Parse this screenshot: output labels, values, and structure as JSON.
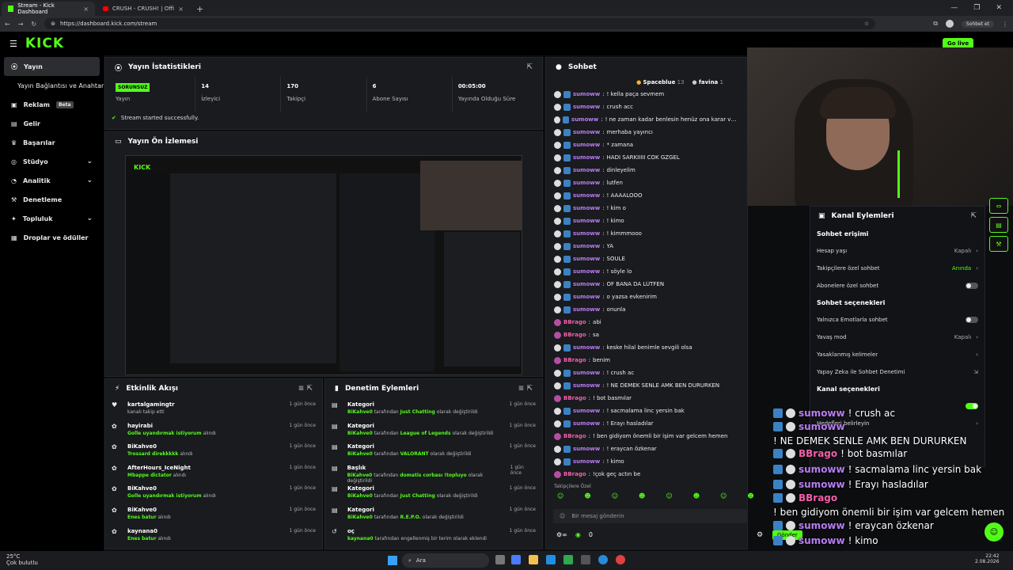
{
  "browser": {
    "tabs": [
      {
        "label": "Stream - Kick Dashboard",
        "active": true
      },
      {
        "label": "CRUSH - CRUSH! | Official Music V",
        "active": false
      }
    ],
    "url": "https://dashboard.kick.com/stream",
    "chat_button": "Sohbet et"
  },
  "topbar": {
    "logo": "KICK",
    "golive": "Go live"
  },
  "sidebar": {
    "items": [
      {
        "label": "Yayın",
        "icon": "broadcast-icon",
        "active": true
      },
      {
        "label": "Yayın Bağlantısı ve Anahtarı",
        "icon": "",
        "sub": true
      },
      {
        "label": "Reklam",
        "icon": "ad-icon",
        "badge": "Beta"
      },
      {
        "label": "Gelir",
        "icon": "revenue-icon"
      },
      {
        "label": "Başarılar",
        "icon": "trophy-icon"
      },
      {
        "label": "Stüdyo",
        "icon": "studio-icon",
        "chevron": true
      },
      {
        "label": "Analitik",
        "icon": "analytics-icon",
        "chevron": true
      },
      {
        "label": "Denetleme",
        "icon": "moderation-icon"
      },
      {
        "label": "Topluluk",
        "icon": "community-icon",
        "chevron": true
      },
      {
        "label": "Droplar ve ödüller",
        "icon": "drops-icon"
      }
    ]
  },
  "stats": {
    "title": "Yayın İstatistikleri",
    "items": [
      {
        "value": "SORUNSUZ",
        "label": "Yayın",
        "tag": true
      },
      {
        "value": "14",
        "label": "İzleyici"
      },
      {
        "value": "170",
        "label": "Takipçi"
      },
      {
        "value": "6",
        "label": "Abone Sayısı"
      },
      {
        "value": "00:05:00",
        "label": "Yayında Olduğu Süre"
      }
    ],
    "status": "Stream started successfully."
  },
  "preview": {
    "title": "Yayın Ön İzlemesi"
  },
  "activity": {
    "title": "Etkinlik Akışı",
    "items": [
      {
        "user": "kartalgamingtr",
        "text": "kanalı takip etti",
        "highlight": "",
        "ago": "1 gün önce",
        "icon": "heart-icon"
      },
      {
        "user": "hayirabi",
        "text": "",
        "highlight": "Golle uyandırmak istiyorum",
        "suffix": "alındı",
        "ago": "1 gün önce",
        "icon": "reward-icon"
      },
      {
        "user": "BiKahve0",
        "text": "",
        "highlight": "Trossard direkkkkk",
        "suffix": "alındı",
        "ago": "1 gün önce",
        "icon": "reward-icon"
      },
      {
        "user": "AfterHours_IceNight",
        "text": "",
        "highlight": "Mbappe dictator",
        "suffix": "alındı",
        "ago": "1 gün önce",
        "icon": "reward-icon"
      },
      {
        "user": "BiKahve0",
        "text": "",
        "highlight": "Golle uyandırmak istiyorum",
        "suffix": "alındı",
        "ago": "1 gün önce",
        "icon": "reward-icon"
      },
      {
        "user": "BiKahve0",
        "text": "",
        "highlight": "Enes batur",
        "suffix": "alındı",
        "ago": "1 gün önce",
        "icon": "reward-icon"
      },
      {
        "user": "kaynana0",
        "text": "",
        "highlight": "Enes batur",
        "suffix": "alındı",
        "ago": "1 gün önce",
        "icon": "reward-icon"
      }
    ]
  },
  "moderation": {
    "title": "Denetim Eylemleri",
    "items": [
      {
        "title": "Kategori",
        "user": "BiKahve0",
        "mid": "tarafından",
        "highlight": "Just Chatting",
        "suffix": "olarak değiştirildi",
        "ago": "1 gün önce",
        "icon": "category-icon"
      },
      {
        "title": "Kategori",
        "user": "BiKahve0",
        "mid": "tarafından",
        "highlight": "League of Legends",
        "suffix": "olarak değiştirildi",
        "ago": "1 gün önce",
        "icon": "category-icon"
      },
      {
        "title": "Kategori",
        "user": "BiKahve0",
        "mid": "tarafından",
        "highlight": "VALORANT",
        "suffix": "olarak değiştirildi",
        "ago": "1 gün önce",
        "icon": "category-icon"
      },
      {
        "title": "Başlık",
        "user": "BiKahve0",
        "mid": "tarafından",
        "highlight": "domatis corbası !topluyo",
        "suffix": "olarak değiştirildi",
        "ago": "1 gün önce",
        "icon": "title-icon"
      },
      {
        "title": "Kategori",
        "user": "BiKahve0",
        "mid": "tarafından",
        "highlight": "Just Chatting",
        "suffix": "olarak değiştirildi",
        "ago": "1 gün önce",
        "icon": "category-icon"
      },
      {
        "title": "Kategori",
        "user": "BiKahve0",
        "mid": "tarafından",
        "highlight": "R.E.P.O.",
        "suffix": "olarak değiştirildi",
        "ago": "1 gün önce",
        "icon": "category-icon"
      },
      {
        "title": "oç",
        "user": "kaynana0",
        "mid": "tarafından engellenmiş bir terim olarak eklendi",
        "highlight": "",
        "suffix": "",
        "ago": "1 gün önce",
        "icon": "undo-icon"
      }
    ]
  },
  "chat": {
    "title": "Sohbet",
    "pinned": [
      {
        "name": "Spaceblue",
        "count": "13"
      },
      {
        "name": "favina",
        "count": "1"
      }
    ],
    "messages": [
      {
        "user": "sumoww",
        "text": "! kella paça sevmem",
        "color": "#b97cf1"
      },
      {
        "user": "sumoww",
        "text": "crush acc",
        "color": "#b97cf1"
      },
      {
        "user": "sumoww",
        "text": "! ne zaman kadar benlesin henüz ona karar vermedim",
        "color": "#b97cf1"
      },
      {
        "user": "sumoww",
        "text": "merhaba yayıncı",
        "color": "#b97cf1"
      },
      {
        "user": "sumoww",
        "text": "* zamana",
        "color": "#b97cf1"
      },
      {
        "user": "sumoww",
        "text": "HADİ SARKIIIII COK GZĞEL",
        "color": "#b97cf1"
      },
      {
        "user": "sumoww",
        "text": "dinleyelim",
        "color": "#b97cf1"
      },
      {
        "user": "sumoww",
        "text": "lutfen",
        "color": "#b97cf1"
      },
      {
        "user": "sumoww",
        "text": "! AAAALOOO",
        "color": "#b97cf1"
      },
      {
        "user": "sumoww",
        "text": "! kim o",
        "color": "#b97cf1"
      },
      {
        "user": "sumoww",
        "text": "! kimo",
        "color": "#b97cf1"
      },
      {
        "user": "sumoww",
        "text": "! kimmmooo",
        "color": "#b97cf1"
      },
      {
        "user": "sumoww",
        "text": "YA",
        "color": "#b97cf1"
      },
      {
        "user": "sumoww",
        "text": "SÖULE",
        "color": "#b97cf1"
      },
      {
        "user": "sumoww",
        "text": "! söyle lo",
        "color": "#b97cf1"
      },
      {
        "user": "sumoww",
        "text": "OF BANA DA LÜTFEN",
        "color": "#b97cf1"
      },
      {
        "user": "sumoww",
        "text": "o yazsa evkenirim",
        "color": "#b97cf1"
      },
      {
        "user": "sumoww",
        "text": "onunla",
        "color": "#b97cf1"
      },
      {
        "user": "BBrago",
        "text": "abi",
        "color": "#f25fa8"
      },
      {
        "user": "BBrago",
        "text": "sa",
        "color": "#f25fa8"
      },
      {
        "user": "sumoww",
        "text": "keske hilal benimle sevgili olsa",
        "color": "#b97cf1"
      },
      {
        "user": "BBrago",
        "text": "benim",
        "color": "#f25fa8"
      },
      {
        "user": "sumoww",
        "text": "! crush ac",
        "color": "#b97cf1"
      },
      {
        "user": "sumoww",
        "text": "! NE DEMEK SENLE AMK BEN DURURKEN",
        "color": "#b97cf1"
      },
      {
        "user": "BBrago",
        "text": "! bot basmılar",
        "color": "#f25fa8"
      },
      {
        "user": "sumoww",
        "text": "! sacmalama linc yersin bak",
        "color": "#b97cf1"
      },
      {
        "user": "sumoww",
        "text": "! Erayı hasladılar",
        "color": "#b97cf1"
      },
      {
        "user": "BBrago",
        "text": "! ben gidiyom önemli bir işim var gelcem hemen",
        "color": "#f25fa8"
      },
      {
        "user": "sumoww",
        "text": "! eraycan özkenar",
        "color": "#b97cf1"
      },
      {
        "user": "sumoww",
        "text": "! kimo",
        "color": "#b97cf1"
      },
      {
        "user": "BBrago",
        "text": "!çok geç actın be",
        "color": "#f25fa8"
      }
    ],
    "followers_only": "Takipçilere Özel",
    "input_placeholder": "Bir mesaj gönderin",
    "send_label": "Gönder",
    "count": "0"
  },
  "channel_actions": {
    "title": "Kanal Eylemleri",
    "section1": "Sohbet erişimi",
    "rows1": [
      {
        "label": "Hesap yaşı",
        "value": "Kapalı",
        "kind": "chev"
      },
      {
        "label": "Takipçilere özel sohbet",
        "value": "Anında",
        "kind": "chev-green"
      },
      {
        "label": "Abonelere özel sohbet",
        "value": "",
        "kind": "toggle-off"
      }
    ],
    "section2": "Sohbet seçenekleri",
    "rows2": [
      {
        "label": "Yalnızca Emotlarla sohbet",
        "value": "",
        "kind": "toggle-off"
      },
      {
        "label": "Yavaş mod",
        "value": "Kapalı",
        "kind": "chev"
      },
      {
        "label": "Yasaklanmış kelimeler",
        "value": "",
        "kind": "chev"
      },
      {
        "label": "Yapay Zeka ile Sohbet Denetimi",
        "value": "",
        "kind": "ext"
      }
    ],
    "section3": "Kanal seçenekleri",
    "rows3": [
      {
        "label": "",
        "value": "",
        "kind": "toggle-on"
      },
      {
        "label": "Hedefleri belirleyin",
        "value": "",
        "kind": "chev"
      }
    ]
  },
  "overlay": [
    {
      "user": "sumoww",
      "text": "! crush ac",
      "color": "#b97cf1"
    },
    {
      "user": "sumoww",
      "text": "! NE DEMEK SENLE AMK BEN DURURKEN",
      "color": "#b97cf1"
    },
    {
      "user": "BBrago",
      "text": "! bot basmılar",
      "color": "#f25fa8"
    },
    {
      "user": "sumoww",
      "text": "! sacmalama linc yersin bak",
      "color": "#b97cf1"
    },
    {
      "user": "sumoww",
      "text": "! Erayı hasladılar",
      "color": "#b97cf1"
    },
    {
      "user": "BBrago",
      "text": "! ben gidiyom önemli bir işim var gelcem hemen",
      "color": "#f25fa8"
    },
    {
      "user": "sumoww",
      "text": "! eraycan özkenar",
      "color": "#b97cf1"
    },
    {
      "user": "sumoww",
      "text": "! kimo",
      "color": "#b97cf1"
    },
    {
      "user": "BBrago",
      "text": "!çok geç actın be",
      "color": "#f25fa8"
    }
  ],
  "taskbar": {
    "weather_temp": "25°C",
    "weather_text": "Çok bulutlu",
    "search": "Ara",
    "time": "22:42",
    "date": "2.08.2026"
  },
  "colors": {
    "accent": "#53fc18",
    "panel": "#191b1f",
    "bg": "#0b0d0f"
  }
}
